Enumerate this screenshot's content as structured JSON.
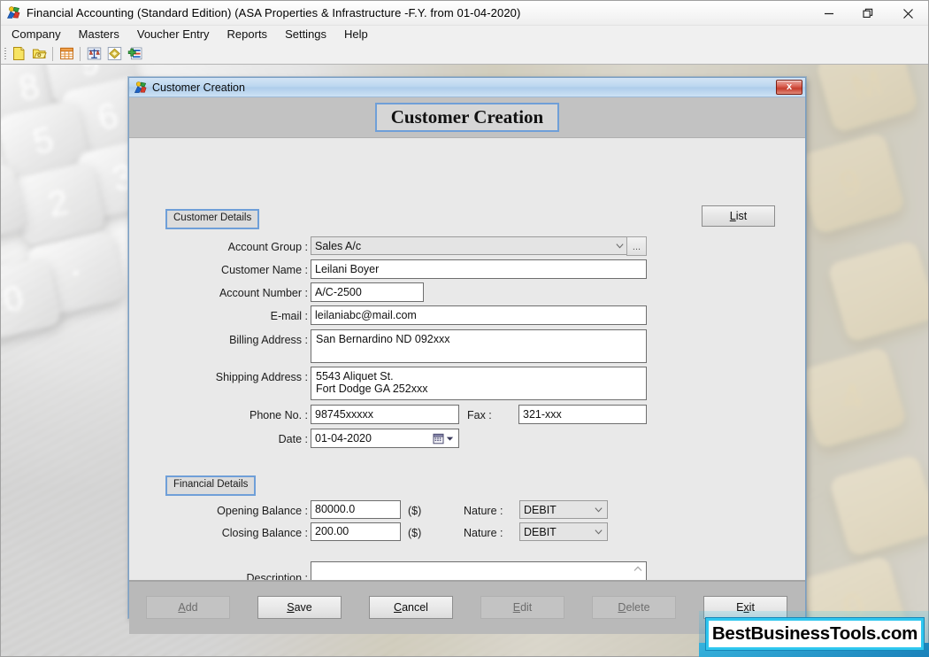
{
  "app": {
    "icon": "app-logo-icon",
    "title": "Financial Accounting (Standard Edition) (ASA Properties & Infrastructure -F.Y.  from 01-04-2020)",
    "window_controls": {
      "minimize": "minimize-icon",
      "restore": "restore-icon",
      "close": "close-icon"
    },
    "menu": [
      {
        "label": "Company"
      },
      {
        "label": "Masters"
      },
      {
        "label": "Voucher Entry"
      },
      {
        "label": "Reports"
      },
      {
        "label": "Settings"
      },
      {
        "label": "Help"
      }
    ],
    "toolbar": [
      {
        "icon": "new-document-icon"
      },
      {
        "icon": "open-folder-icon"
      },
      {
        "icon": "calendar-grid-icon"
      },
      {
        "icon": "balance-scales-icon"
      },
      {
        "icon": "diamond-ledger-icon"
      },
      {
        "icon": "add-entry-icon"
      }
    ]
  },
  "dialog": {
    "titlebar": {
      "icon": "app-logo-icon",
      "title": "Customer Creation",
      "close_label": "x"
    },
    "header_title": "Customer Creation",
    "list_button": {
      "accel": "L",
      "rest": "ist"
    },
    "sections": {
      "customer_details": "Customer Details",
      "financial_details": "Financial Details"
    },
    "fields": {
      "account_group": {
        "label": "Account Group :",
        "value": "Sales A/c",
        "browse": "..."
      },
      "customer_name": {
        "label": "Customer Name :",
        "value": "Leilani Boyer"
      },
      "account_number": {
        "label": "Account Number :",
        "value": "A/C-2500"
      },
      "email": {
        "label": "E-mail :",
        "value": "leilaniabc@mail.com"
      },
      "billing_address": {
        "label": "Billing Address :",
        "value": "San Bernardino ND 092xxx"
      },
      "shipping_address": {
        "label": "Shipping Address :",
        "value": "5543 Aliquet St.\nFort Dodge GA 252xxx"
      },
      "phone": {
        "label": "Phone No. :",
        "value": "98745xxxxx"
      },
      "fax": {
        "label": "Fax :",
        "value": "321-xxx"
      },
      "date": {
        "label": "Date :",
        "value": "01-04-2020"
      },
      "opening_balance": {
        "label": "Opening Balance :",
        "value": "80000.0",
        "currency": "($)"
      },
      "opening_nature": {
        "label": "Nature :",
        "value": "DEBIT"
      },
      "closing_balance": {
        "label": "Closing Balance :",
        "value": "200.00",
        "currency": "($)"
      },
      "closing_nature": {
        "label": "Nature :",
        "value": "DEBIT"
      },
      "description": {
        "label": "Description :",
        "value": ""
      }
    },
    "buttons": [
      {
        "name": "add",
        "accel": "A",
        "pre": "",
        "rest": "dd",
        "disabled": true
      },
      {
        "name": "save",
        "accel": "S",
        "pre": "",
        "rest": "ave",
        "disabled": false
      },
      {
        "name": "cancel",
        "accel": "C",
        "pre": "",
        "rest": "ancel",
        "disabled": false
      },
      {
        "name": "edit",
        "accel": "E",
        "pre": "",
        "rest": "dit",
        "disabled": true
      },
      {
        "name": "delete",
        "accel": "D",
        "pre": "",
        "rest": "elete",
        "disabled": true
      },
      {
        "name": "exit",
        "accel": "x",
        "pre": "E",
        "rest": "it",
        "disabled": false
      }
    ]
  },
  "watermark": {
    "text": "BestBusinessTools.com"
  },
  "colors": {
    "dialog_border": "#7a9fc4",
    "section_tab_border": "#6f9fd8",
    "close_button": "#c63d2c",
    "watermark_border": "#2fc7ef"
  }
}
